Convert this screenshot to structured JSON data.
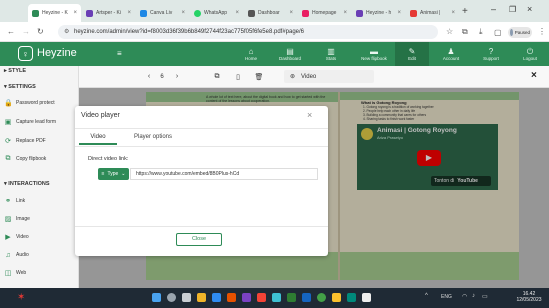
{
  "browser": {
    "tabs": [
      {
        "label": "Heyzine - K",
        "active": true,
        "color": "#2e8b57"
      },
      {
        "label": "Artsper - Ki",
        "active": false,
        "color": "#6a3fb5"
      },
      {
        "label": "Canva Liv",
        "active": false,
        "color": "#1e88e5"
      },
      {
        "label": "WhatsApp",
        "active": false,
        "color": "#25d366"
      },
      {
        "label": "Dashboar",
        "active": false,
        "color": "#555555"
      },
      {
        "label": "Homepage",
        "active": false,
        "color": "#e91e63"
      },
      {
        "label": "Heyzine - h",
        "active": false,
        "color": "#6a3fb5"
      },
      {
        "label": "Animasi |",
        "active": false,
        "color": "#e53935"
      }
    ],
    "new_tab": "+",
    "url": "heyzine.com/admin/view?id=f8003d36f39b6b849f2744f23ac775f05f6fe5e8.pdf#page/6",
    "profile_label": "Paused"
  },
  "app": {
    "logo": "Heyzine",
    "nav": [
      {
        "label": "Home",
        "icon": "⌂"
      },
      {
        "label": "Dashboard",
        "icon": "▤"
      },
      {
        "label": "Stats",
        "icon": "▥"
      },
      {
        "label": "New flipbook",
        "icon": "▬"
      },
      {
        "label": "Edit",
        "icon": "✎"
      },
      {
        "label": "Account",
        "icon": "♟"
      },
      {
        "label": "Support",
        "icon": "?"
      },
      {
        "label": "Logout",
        "icon": "⏻"
      }
    ]
  },
  "sidebar": {
    "style_header": "STYLE",
    "settings_header": "SETTINGS",
    "settings_items": [
      "Password protect",
      "Capture lead form",
      "Replace PDF",
      "Copy flipbook"
    ],
    "interactions_header": "INTERACTIONS",
    "interaction_items": [
      "Link",
      "Image",
      "Video",
      "Audio",
      "Web"
    ]
  },
  "toolbar": {
    "page_number": "6",
    "prev": "‹",
    "next": "›",
    "mode_label": "Video",
    "close": "×"
  },
  "book": {
    "left_text": "A whole lot of text here, about the digital book and how to get started with the content of the lessons about cooperation.",
    "right_title": "What is Gotong Royong",
    "right_lines": [
      "1. Gotong royong is a tradition of working together",
      "2. People help each other in daily life",
      "3. Building a community that cares for others",
      "4. Sharing tasks to finish work faster"
    ],
    "video_title": "Animasi | Gotong Royong",
    "video_channel": "Ariza Prasetyo",
    "video_watch": "Tonton di",
    "video_yt": "YouTube"
  },
  "modal": {
    "title": "Video player",
    "close": "×",
    "tabs": [
      "Video",
      "Player options"
    ],
    "field_label": "Direct video link:",
    "type_label": "Type",
    "link_value": "https://www.youtube.com/embed/8B0Plus-hCd",
    "close_button": "Close"
  },
  "taskbar": {
    "lang": "ENG",
    "time": "16.42",
    "date": "12/05/2023"
  },
  "colors": {
    "brand": "#2e8b57",
    "sidebar": "#f4f4f4",
    "taskbar": "#1f2a35"
  }
}
